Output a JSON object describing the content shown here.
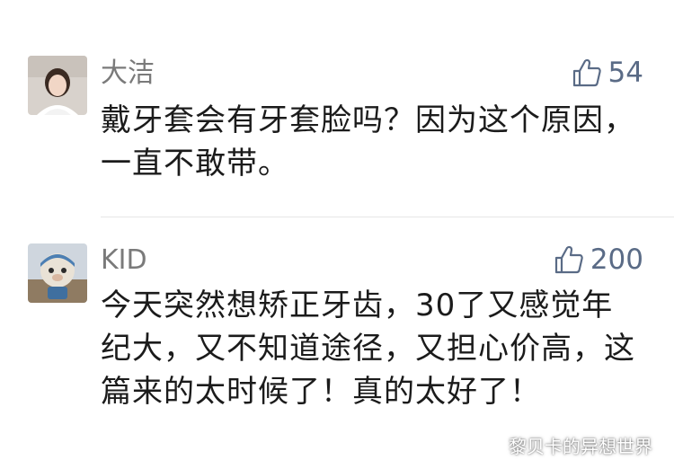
{
  "comments": [
    {
      "username": "大洁",
      "likes": "54",
      "text": "戴牙套会有牙套脸吗？因为这个原因，一直不敢带。"
    },
    {
      "username": "KID",
      "likes": "200",
      "text": "今天突然想矫正牙齿，30了又感觉年纪大，又不知道途径，又担心价高，这篇来的太时候了！真的太好了！"
    }
  ],
  "icons": {
    "like": "thumbs-up-icon",
    "watermark": "wechat-icon"
  },
  "watermark": {
    "text": "黎贝卡的异想世界"
  },
  "colors": {
    "username": "#7a7a7a",
    "like": "#5a6b86",
    "text": "#1b1b1b"
  }
}
